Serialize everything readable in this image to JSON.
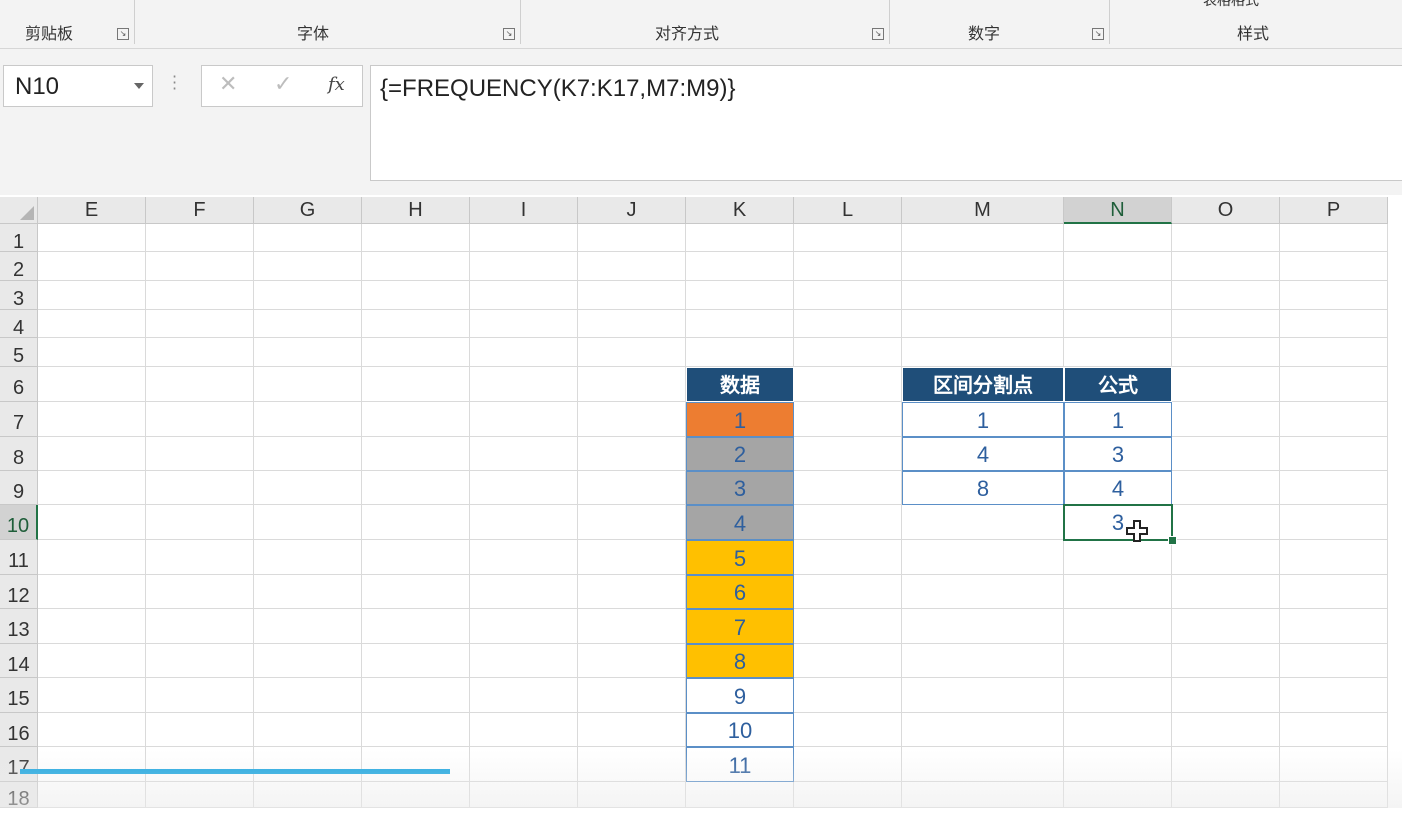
{
  "ribbon": {
    "groups": [
      {
        "label": "剪贴板"
      },
      {
        "label": "字体"
      },
      {
        "label": "对齐方式"
      },
      {
        "label": "数字"
      },
      {
        "label": "样式"
      }
    ],
    "top_cut_text": "表格格式"
  },
  "formula_bar": {
    "name_box": "N10",
    "cancel_symbol": "✕",
    "enter_symbol": "✓",
    "fx_symbol": "fx",
    "formula": "{=FREQUENCY(K7:K17,M7:M9)}"
  },
  "grid": {
    "columns": [
      "E",
      "F",
      "G",
      "H",
      "I",
      "J",
      "K",
      "L",
      "M",
      "N",
      "O",
      "P"
    ],
    "rows": [
      "1",
      "2",
      "3",
      "4",
      "5",
      "6",
      "7",
      "8",
      "9",
      "10",
      "11",
      "12",
      "13",
      "14",
      "15",
      "16",
      "17",
      "18"
    ],
    "active_column": "N",
    "active_row": "10"
  },
  "table_data": {
    "header": "数据",
    "values": [
      "1",
      "2",
      "3",
      "4",
      "5",
      "6",
      "7",
      "8",
      "9",
      "10",
      "11"
    ],
    "fill_colors": [
      "#ed7d31",
      "#a5a5a5",
      "#a5a5a5",
      "#a5a5a5",
      "#ffc000",
      "#ffc000",
      "#ffc000",
      "#ffc000",
      "#ffffff",
      "#ffffff",
      "#ffffff"
    ]
  },
  "table_breakpoints": {
    "header_points": "区间分割点",
    "header_formula": "公式",
    "points": [
      "1",
      "4",
      "8"
    ],
    "results": [
      "1",
      "3",
      "4",
      "3"
    ]
  },
  "colors": {
    "header_bg": "#1f4e79",
    "value_text": "#2e5f9e",
    "selection": "#217346",
    "scrollbar": "#19a5e0"
  }
}
